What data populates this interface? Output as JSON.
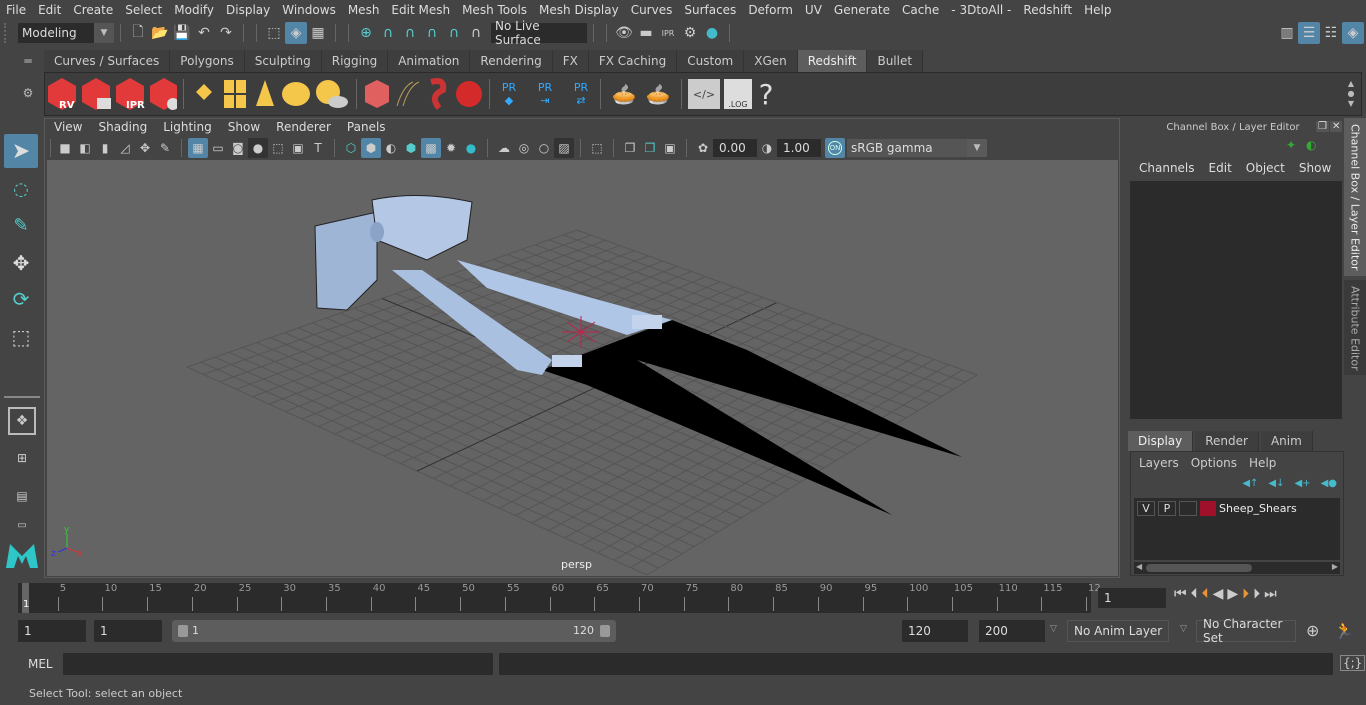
{
  "menubar": {
    "items": [
      "File",
      "Edit",
      "Create",
      "Select",
      "Modify",
      "Display",
      "Windows",
      "Mesh",
      "Edit Mesh",
      "Mesh Tools",
      "Mesh Display",
      "Curves",
      "Surfaces",
      "Deform",
      "UV",
      "Generate",
      "Cache",
      "- 3DtoAll -",
      "Redshift",
      "Help"
    ]
  },
  "statusline": {
    "mode": "Modeling",
    "live_surface": "No Live Surface"
  },
  "shelf": {
    "tabs": [
      "Curves / Surfaces",
      "Polygons",
      "Sculpting",
      "Rigging",
      "Animation",
      "Rendering",
      "FX",
      "FX Caching",
      "Custom",
      "XGen",
      "Redshift",
      "Bullet"
    ],
    "active_tab": "Redshift",
    "icon_labels": {
      "rv": "RV",
      "ipr": "IPR",
      "pr": "PR",
      "log": ".LOG",
      "help": "?"
    }
  },
  "viewport": {
    "menu": [
      "View",
      "Shading",
      "Lighting",
      "Show",
      "Renderer",
      "Panels"
    ],
    "exposure": "0.00",
    "gamma": "1.00",
    "colorspace_toggle": "ON",
    "colorspace": "sRGB gamma",
    "camera_label": "persp",
    "axis": {
      "x": "x",
      "y": "y",
      "z": "z"
    },
    "model_name": "Sheep_Shears",
    "colors": {
      "model": "#a6bcdc",
      "shadow": "#000000",
      "background": "#646464",
      "grid": "#555555",
      "pivot": "#c0224a"
    }
  },
  "channel_box": {
    "title": "Channel Box / Layer Editor",
    "menu": [
      "Channels",
      "Edit",
      "Object",
      "Show"
    ],
    "layer_tabs": [
      "Display",
      "Render",
      "Anim"
    ],
    "active_layer_tab": "Display",
    "layer_menu": [
      "Layers",
      "Options",
      "Help"
    ],
    "layers": [
      {
        "v": "V",
        "p": "P",
        "name": "Sheep_Shears",
        "color": "#a0102a"
      }
    ]
  },
  "side_tabs": [
    "Channel Box / Layer Editor",
    "Attribute Editor"
  ],
  "timeline": {
    "ticks": [
      "5",
      "10",
      "15",
      "20",
      "25",
      "30",
      "35",
      "40",
      "45",
      "50",
      "55",
      "60",
      "65",
      "70",
      "75",
      "80",
      "85",
      "90",
      "95",
      "100",
      "105",
      "110",
      "115",
      "12"
    ],
    "current_marker": "1",
    "current_frame": "1"
  },
  "range": {
    "start": "1",
    "playback_start": "1",
    "slider_min": "1",
    "slider_max": "120",
    "playback_end": "120",
    "end": "200",
    "anim_layer": "No Anim Layer",
    "character_set": "No Character Set"
  },
  "cmdline": {
    "label": "MEL"
  },
  "helpline": {
    "text": "Select Tool: select an object"
  }
}
